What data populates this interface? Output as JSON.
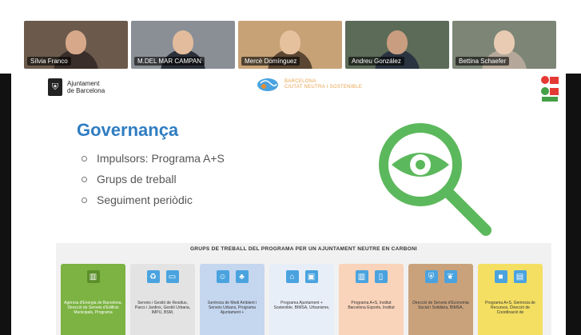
{
  "participants": [
    {
      "name": "Sílvia Franco",
      "bg": "#6b5a4c",
      "skin": "#d8a88a",
      "shirt": "#3a2e2a"
    },
    {
      "name": "M.DEL MAR CAMPAN",
      "bg": "#8a8f96",
      "skin": "#e2bc9c",
      "shirt": "#2b2f38"
    },
    {
      "name": "Mercè Domínguez",
      "bg": "#c7a277",
      "skin": "#e6c19e",
      "shirt": "#5a4632"
    },
    {
      "name": "Andreu González",
      "bg": "#5c6b58",
      "skin": "#c99d80",
      "shirt": "#2a3440"
    },
    {
      "name": "Bettina Schaefer",
      "bg": "#7d8676",
      "skin": "#e9cbb4",
      "shirt": "#b5a89a"
    }
  ],
  "slide": {
    "logo_bcn": [
      "Ajuntament",
      "de Barcelona"
    ],
    "logo_ns": [
      "BARCELONA",
      "CIUTAT NEUTRA I SOSTENIBLE"
    ],
    "title": "Governança",
    "bullets": [
      "Impulsors: Programa A+S",
      "Grups de treball",
      "Seguiment periòdic"
    ],
    "groups_title": "GRUPS DE TREBALL DEL PROGRAMA PER UN AJUNTAMENT NEUTRE EN CARBONI",
    "accent_color": "#5cb85c",
    "cards": [
      {
        "label": "Agència d'Energia de Barcelona, Direcció de Serveis d'Edificis Municipals, Programa",
        "color": "#7cb342",
        "icons": [
          "building-icon"
        ]
      },
      {
        "label": "Serveis i Gestió de Residus, Parcs i Jardins, Gestió Urbana, IMPU, BSM,",
        "color": "#e3e3e3",
        "icons": [
          "recycle-icon",
          "car-icon"
        ]
      },
      {
        "label": "Gerència de Medi Ambient i Serveis Urbans, Programa Ajuntament +",
        "color": "#c5d6ef",
        "icons": [
          "person-icon",
          "tree-icon"
        ]
      },
      {
        "label": "Programa Ajuntament + Sostenible, BIMSA, Urbanisme,",
        "color": "#e8eef7",
        "icons": [
          "factory-icon",
          "bus-icon"
        ]
      },
      {
        "label": "Programa A+S, Institut Barcelona Esports, Institut",
        "color": "#f9d3ba",
        "icons": [
          "building-icon",
          "tower-icon"
        ]
      },
      {
        "label": "Direcció de Serveis d'Economia Social i Solidària, BIMSA,",
        "color": "#c9a27c",
        "icons": [
          "shield-icon",
          "leaf-icon"
        ]
      },
      {
        "label": "Programa A+S, Gerència de Recursos, Direcció de Coordinació de",
        "color": "#f4df63",
        "icons": [
          "box-icon",
          "doc-icon"
        ]
      }
    ]
  }
}
